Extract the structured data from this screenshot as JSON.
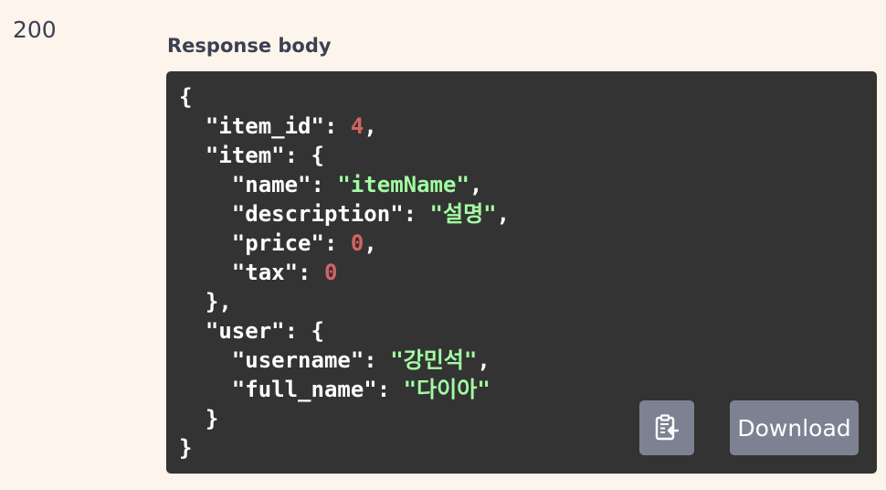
{
  "response": {
    "status_code": "200",
    "body_title": "Response body"
  },
  "code_lines": [
    [
      {
        "t": "{",
        "k": "punct"
      }
    ],
    [
      {
        "t": "  \"item_id\"",
        "k": "key"
      },
      {
        "t": ": ",
        "k": "punct"
      },
      {
        "t": "4",
        "k": "num"
      },
      {
        "t": ",",
        "k": "punct"
      }
    ],
    [
      {
        "t": "  \"item\"",
        "k": "key"
      },
      {
        "t": ": {",
        "k": "punct"
      }
    ],
    [
      {
        "t": "    \"name\"",
        "k": "key"
      },
      {
        "t": ": ",
        "k": "punct"
      },
      {
        "t": "\"itemName\"",
        "k": "str"
      },
      {
        "t": ",",
        "k": "punct"
      }
    ],
    [
      {
        "t": "    \"description\"",
        "k": "key"
      },
      {
        "t": ": ",
        "k": "punct"
      },
      {
        "t": "\"설명\"",
        "k": "str"
      },
      {
        "t": ",",
        "k": "punct"
      }
    ],
    [
      {
        "t": "    \"price\"",
        "k": "key"
      },
      {
        "t": ": ",
        "k": "punct"
      },
      {
        "t": "0",
        "k": "num"
      },
      {
        "t": ",",
        "k": "punct"
      }
    ],
    [
      {
        "t": "    \"tax\"",
        "k": "key"
      },
      {
        "t": ": ",
        "k": "punct"
      },
      {
        "t": "0",
        "k": "num"
      }
    ],
    [
      {
        "t": "  },",
        "k": "punct"
      }
    ],
    [
      {
        "t": "  \"user\"",
        "k": "key"
      },
      {
        "t": ": {",
        "k": "punct"
      }
    ],
    [
      {
        "t": "    \"username\"",
        "k": "key"
      },
      {
        "t": ": ",
        "k": "punct"
      },
      {
        "t": "\"강민석\"",
        "k": "str"
      },
      {
        "t": ",",
        "k": "punct"
      }
    ],
    [
      {
        "t": "    \"full_name\"",
        "k": "key"
      },
      {
        "t": ": ",
        "k": "punct"
      },
      {
        "t": "\"다이아\"",
        "k": "str"
      }
    ],
    [
      {
        "t": "  }",
        "k": "punct"
      }
    ],
    [
      {
        "t": "}",
        "k": "punct"
      }
    ]
  ],
  "actions": {
    "copy_icon": "clipboard-icon",
    "download_label": "Download"
  },
  "colors": {
    "background": "#fdf4ec",
    "code_background": "#333333",
    "number": "#d36363",
    "string": "#a2fca2",
    "button": "#7d8293"
  }
}
